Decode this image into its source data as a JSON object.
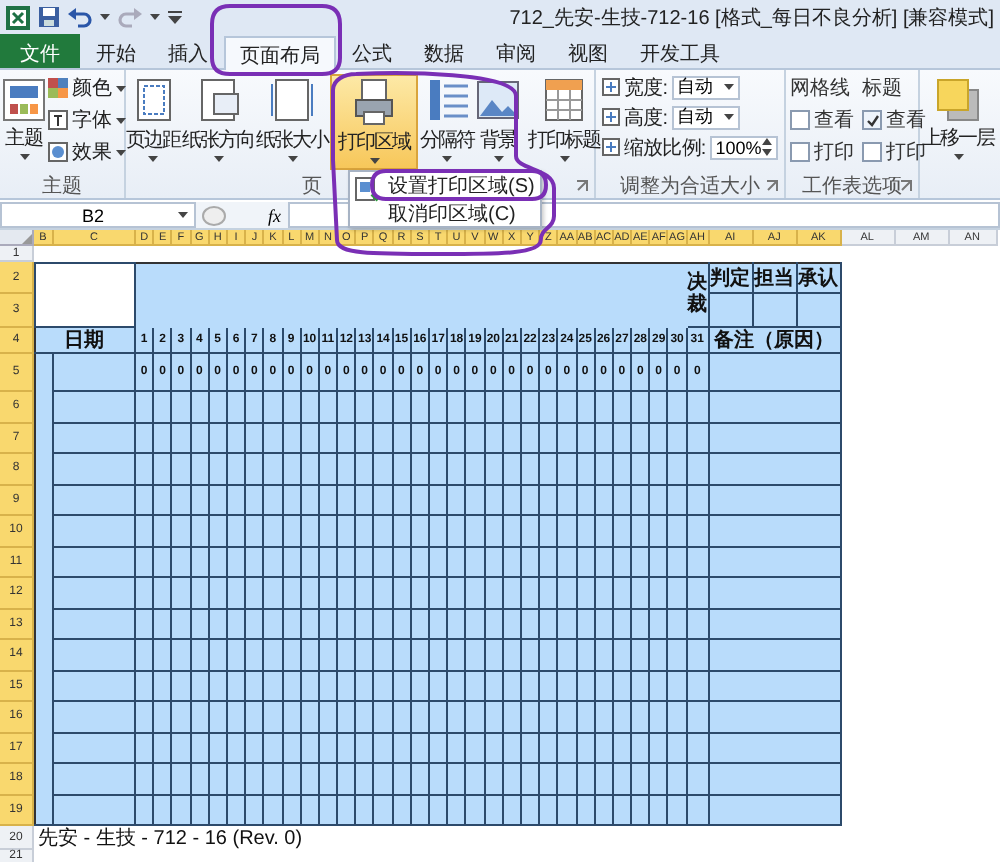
{
  "window": {
    "title": "712_先安-生技-712-16 [格式_每日不良分析] [兼容模式]"
  },
  "ribbon_tabs": [
    {
      "label": "文件",
      "kind": "file",
      "selected": false
    },
    {
      "label": "开始",
      "kind": "tab",
      "selected": false
    },
    {
      "label": "插入",
      "kind": "tab",
      "selected": false
    },
    {
      "label": "页面布局",
      "kind": "tab",
      "selected": true
    },
    {
      "label": "公式",
      "kind": "tab",
      "selected": false
    },
    {
      "label": "数据",
      "kind": "tab",
      "selected": false
    },
    {
      "label": "审阅",
      "kind": "tab",
      "selected": false
    },
    {
      "label": "视图",
      "kind": "tab",
      "selected": false
    },
    {
      "label": "开发工具",
      "kind": "tab",
      "selected": false
    }
  ],
  "ribbon": {
    "theme_group": {
      "title": "主题",
      "main_button": "主题",
      "options": [
        "颜色",
        "字体",
        "效果"
      ]
    },
    "page_setup_group": {
      "title": "页",
      "buttons": [
        {
          "label": "页边距",
          "selected": false
        },
        {
          "label": "纸张方向",
          "selected": false
        },
        {
          "label": "纸张大小",
          "selected": false
        },
        {
          "label": "打印区域",
          "selected": true
        },
        {
          "label": "分隔符",
          "selected": false
        },
        {
          "label": "背景",
          "selected": false
        },
        {
          "label": "打印标题",
          "selected": false
        }
      ]
    },
    "scale_group": {
      "title": "调整为合适大小",
      "fields": [
        {
          "label": "宽度:",
          "value": "自动",
          "kind": "select"
        },
        {
          "label": "高度:",
          "value": "自动",
          "kind": "select"
        },
        {
          "label": "缩放比例:",
          "value": "100%",
          "kind": "spinner"
        }
      ]
    },
    "sheet_options_group": {
      "title": "工作表选项",
      "columns": [
        {
          "heading": "网格线",
          "options": [
            {
              "label": "查看",
              "checked": false
            },
            {
              "label": "打印",
              "checked": false
            }
          ]
        },
        {
          "heading": "标题",
          "options": [
            {
              "label": "查看",
              "checked": true
            },
            {
              "label": "打印",
              "checked": false
            }
          ]
        }
      ]
    },
    "arrange_group": {
      "buttons": [
        {
          "label": "上移一层"
        }
      ]
    }
  },
  "dropdown_menu": {
    "items": [
      {
        "label": "设置打印区域(S)"
      },
      {
        "label": "取消印区域(C)"
      }
    ]
  },
  "formula_bar": {
    "name_box": "B2",
    "function_label": "fx"
  },
  "sheet": {
    "columns": [
      {
        "label": "B",
        "selected": true
      },
      {
        "label": "C",
        "selected": true
      },
      {
        "label": "D",
        "selected": true
      },
      {
        "label": "E",
        "selected": true
      },
      {
        "label": "F",
        "selected": true
      },
      {
        "label": "G",
        "selected": true
      },
      {
        "label": "H",
        "selected": true
      },
      {
        "label": "I",
        "selected": true
      },
      {
        "label": "J",
        "selected": true
      },
      {
        "label": "K",
        "selected": true
      },
      {
        "label": "L",
        "selected": true
      },
      {
        "label": "M",
        "selected": true
      },
      {
        "label": "N",
        "selected": true
      },
      {
        "label": "O",
        "selected": true
      },
      {
        "label": "P",
        "selected": true
      },
      {
        "label": "Q",
        "selected": true
      },
      {
        "label": "R",
        "selected": true
      },
      {
        "label": "S",
        "selected": true
      },
      {
        "label": "T",
        "selected": true
      },
      {
        "label": "U",
        "selected": true
      },
      {
        "label": "V",
        "selected": true
      },
      {
        "label": "W",
        "selected": true
      },
      {
        "label": "X",
        "selected": true
      },
      {
        "label": "Y",
        "selected": true
      },
      {
        "label": "Z",
        "selected": true
      },
      {
        "label": "AA",
        "selected": true
      },
      {
        "label": "AB",
        "selected": true
      },
      {
        "label": "AC",
        "selected": true
      },
      {
        "label": "AD",
        "selected": true
      },
      {
        "label": "AE",
        "selected": true
      },
      {
        "label": "AF",
        "selected": true
      },
      {
        "label": "AG",
        "selected": true
      },
      {
        "label": "AH",
        "selected": true
      },
      {
        "label": "AI",
        "selected": true
      },
      {
        "label": "AJ",
        "selected": true
      },
      {
        "label": "AK",
        "selected": true
      },
      {
        "label": "AL",
        "selected": false
      },
      {
        "label": "AM",
        "selected": false
      },
      {
        "label": "AN",
        "selected": false
      }
    ],
    "rows": [
      {
        "label": "1",
        "selected": false
      },
      {
        "label": "2",
        "selected": true
      },
      {
        "label": "3",
        "selected": true
      },
      {
        "label": "4",
        "selected": true
      },
      {
        "label": "5",
        "selected": true
      },
      {
        "label": "6",
        "selected": true
      },
      {
        "label": "7",
        "selected": true
      },
      {
        "label": "8",
        "selected": true
      },
      {
        "label": "9",
        "selected": true
      },
      {
        "label": "10",
        "selected": true
      },
      {
        "label": "11",
        "selected": true
      },
      {
        "label": "12",
        "selected": true
      },
      {
        "label": "13",
        "selected": true
      },
      {
        "label": "14",
        "selected": true
      },
      {
        "label": "15",
        "selected": true
      },
      {
        "label": "16",
        "selected": true
      },
      {
        "label": "17",
        "selected": true
      },
      {
        "label": "18",
        "selected": true
      },
      {
        "label": "19",
        "selected": true
      },
      {
        "label": "20",
        "selected": false
      },
      {
        "label": "21",
        "selected": false
      }
    ],
    "form": {
      "approval_label": "决裁",
      "approvals": [
        "判定",
        "担当",
        "承认"
      ],
      "date_label": "日期",
      "remark_label": "备注（原因）",
      "days": [
        {
          "day": "1",
          "total": "0"
        },
        {
          "day": "2",
          "total": "0"
        },
        {
          "day": "3",
          "total": "0"
        },
        {
          "day": "4",
          "total": "0"
        },
        {
          "day": "5",
          "total": "0"
        },
        {
          "day": "6",
          "total": "0"
        },
        {
          "day": "7",
          "total": "0"
        },
        {
          "day": "8",
          "total": "0"
        },
        {
          "day": "9",
          "total": "0"
        },
        {
          "day": "10",
          "total": "0"
        },
        {
          "day": "11",
          "total": "0"
        },
        {
          "day": "12",
          "total": "0"
        },
        {
          "day": "13",
          "total": "0"
        },
        {
          "day": "14",
          "total": "0"
        },
        {
          "day": "15",
          "total": "0"
        },
        {
          "day": "16",
          "total": "0"
        },
        {
          "day": "17",
          "total": "0"
        },
        {
          "day": "18",
          "total": "0"
        },
        {
          "day": "19",
          "total": "0"
        },
        {
          "day": "20",
          "total": "0"
        },
        {
          "day": "21",
          "total": "0"
        },
        {
          "day": "22",
          "total": "0"
        },
        {
          "day": "23",
          "total": "0"
        },
        {
          "day": "24",
          "total": "0"
        },
        {
          "day": "25",
          "total": "0"
        },
        {
          "day": "26",
          "total": "0"
        },
        {
          "day": "27",
          "total": "0"
        },
        {
          "day": "28",
          "total": "0"
        },
        {
          "day": "29",
          "total": "0"
        },
        {
          "day": "30",
          "total": "0"
        },
        {
          "day": "31",
          "total": "0"
        }
      ],
      "footer": "先安 - 生技 - 712 - 16 (Rev. 0)"
    }
  }
}
